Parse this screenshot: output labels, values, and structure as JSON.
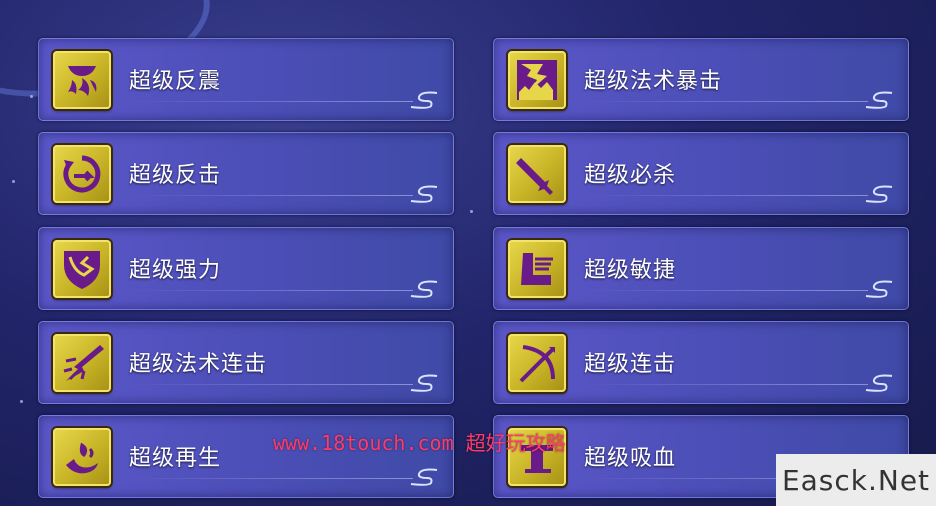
{
  "skills": [
    {
      "name": "超级反震",
      "icon": "flame-pot-icon"
    },
    {
      "name": "超级法术暴击",
      "icon": "lightning-icon"
    },
    {
      "name": "超级反击",
      "icon": "counter-arrow-icon"
    },
    {
      "name": "超级必杀",
      "icon": "sword-icon"
    },
    {
      "name": "超级强力",
      "icon": "broken-shield-icon"
    },
    {
      "name": "超级敏捷",
      "icon": "winged-boot-icon"
    },
    {
      "name": "超级法术连击",
      "icon": "magic-burst-icon"
    },
    {
      "name": "超级连击",
      "icon": "crossed-bow-icon"
    },
    {
      "name": "超级再生",
      "icon": "regen-icon"
    },
    {
      "name": "超级吸血",
      "icon": "blood-icon"
    }
  ],
  "watermark": "www.18touch.com 超好玩攻略",
  "badge": "Easck.Net",
  "colors": {
    "panel": "#4d4fb8",
    "icon_gold": "#d8c838",
    "icon_purple": "#6a1b8a",
    "watermark": "#ff3a6a"
  }
}
